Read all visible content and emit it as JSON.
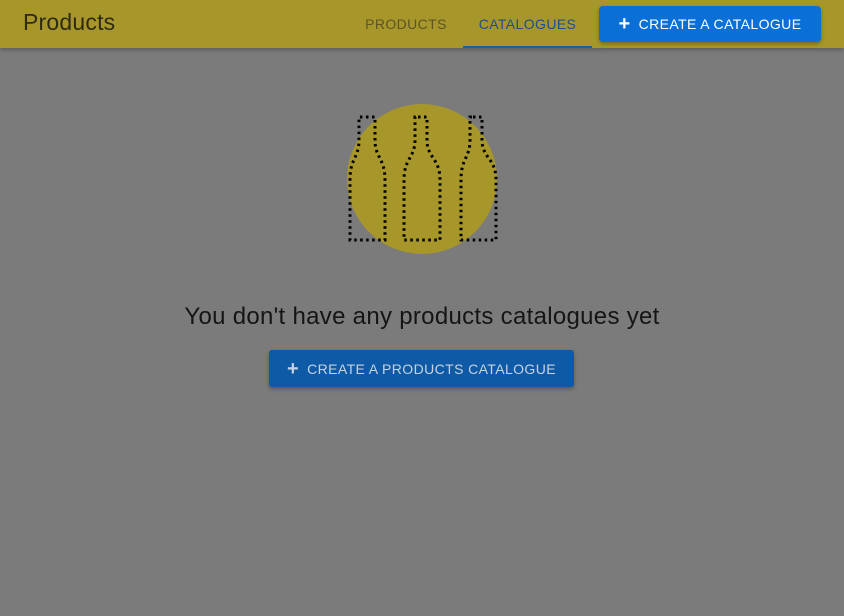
{
  "header": {
    "title": "Products",
    "tabs": [
      {
        "label": "PRODUCTS",
        "active": false
      },
      {
        "label": "CATALOGUES",
        "active": true
      }
    ],
    "create_button_label": "CREATE A CATALOGUE",
    "create_button_icon": "plus-icon"
  },
  "empty_state": {
    "illustration_icon": "bottles-icon",
    "message": "You don't have any products catalogues yet",
    "button_label": "CREATE A PRODUCTS CATALOGUE",
    "button_icon": "plus-icon"
  },
  "colors": {
    "header_bg": "#a7972a",
    "accent": "#0a6fd6",
    "page_bg": "#7b7b7b",
    "illustration_circle": "#a7972a"
  }
}
